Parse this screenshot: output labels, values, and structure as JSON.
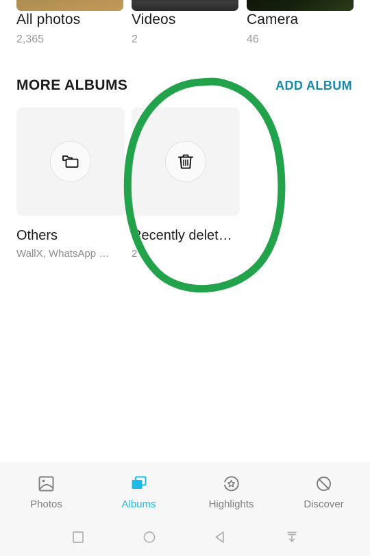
{
  "top_albums": [
    {
      "title": "All photos",
      "count": "2,365",
      "thumb": "photo-thumbnail"
    },
    {
      "title": "Videos",
      "count": "2",
      "thumb": "video-thumbnail"
    },
    {
      "title": "Camera",
      "count": "46",
      "thumb": "camera-thumbnail"
    }
  ],
  "more_albums_section": {
    "title": "MORE ALBUMS",
    "add_album_label": "ADD ALBUM",
    "add_album_color": "#1a8aa8",
    "items": [
      {
        "name": "Others",
        "subtitle": "WallX, WhatsApp …",
        "icon": "folders-icon"
      },
      {
        "name": "Recently delet…",
        "subtitle": "2",
        "icon": "trash-icon"
      }
    ]
  },
  "annotation": {
    "type": "hand-drawn-ellipse",
    "color": "#22a24a",
    "target": "Recently delet…"
  },
  "bottom_nav": {
    "active": "Albums",
    "active_color": "#19bde8",
    "items": [
      {
        "label": "Photos",
        "icon": "photo-icon"
      },
      {
        "label": "Albums",
        "icon": "albums-stack-icon"
      },
      {
        "label": "Highlights",
        "icon": "highlights-star-icon"
      },
      {
        "label": "Discover",
        "icon": "discover-globe-icon"
      }
    ]
  },
  "system_nav": {
    "items": [
      {
        "name": "recents",
        "icon": "square-icon"
      },
      {
        "name": "home",
        "icon": "circle-icon"
      },
      {
        "name": "back",
        "icon": "triangle-left-icon"
      },
      {
        "name": "hide-navbar",
        "icon": "arrow-down-bar-icon"
      }
    ]
  }
}
